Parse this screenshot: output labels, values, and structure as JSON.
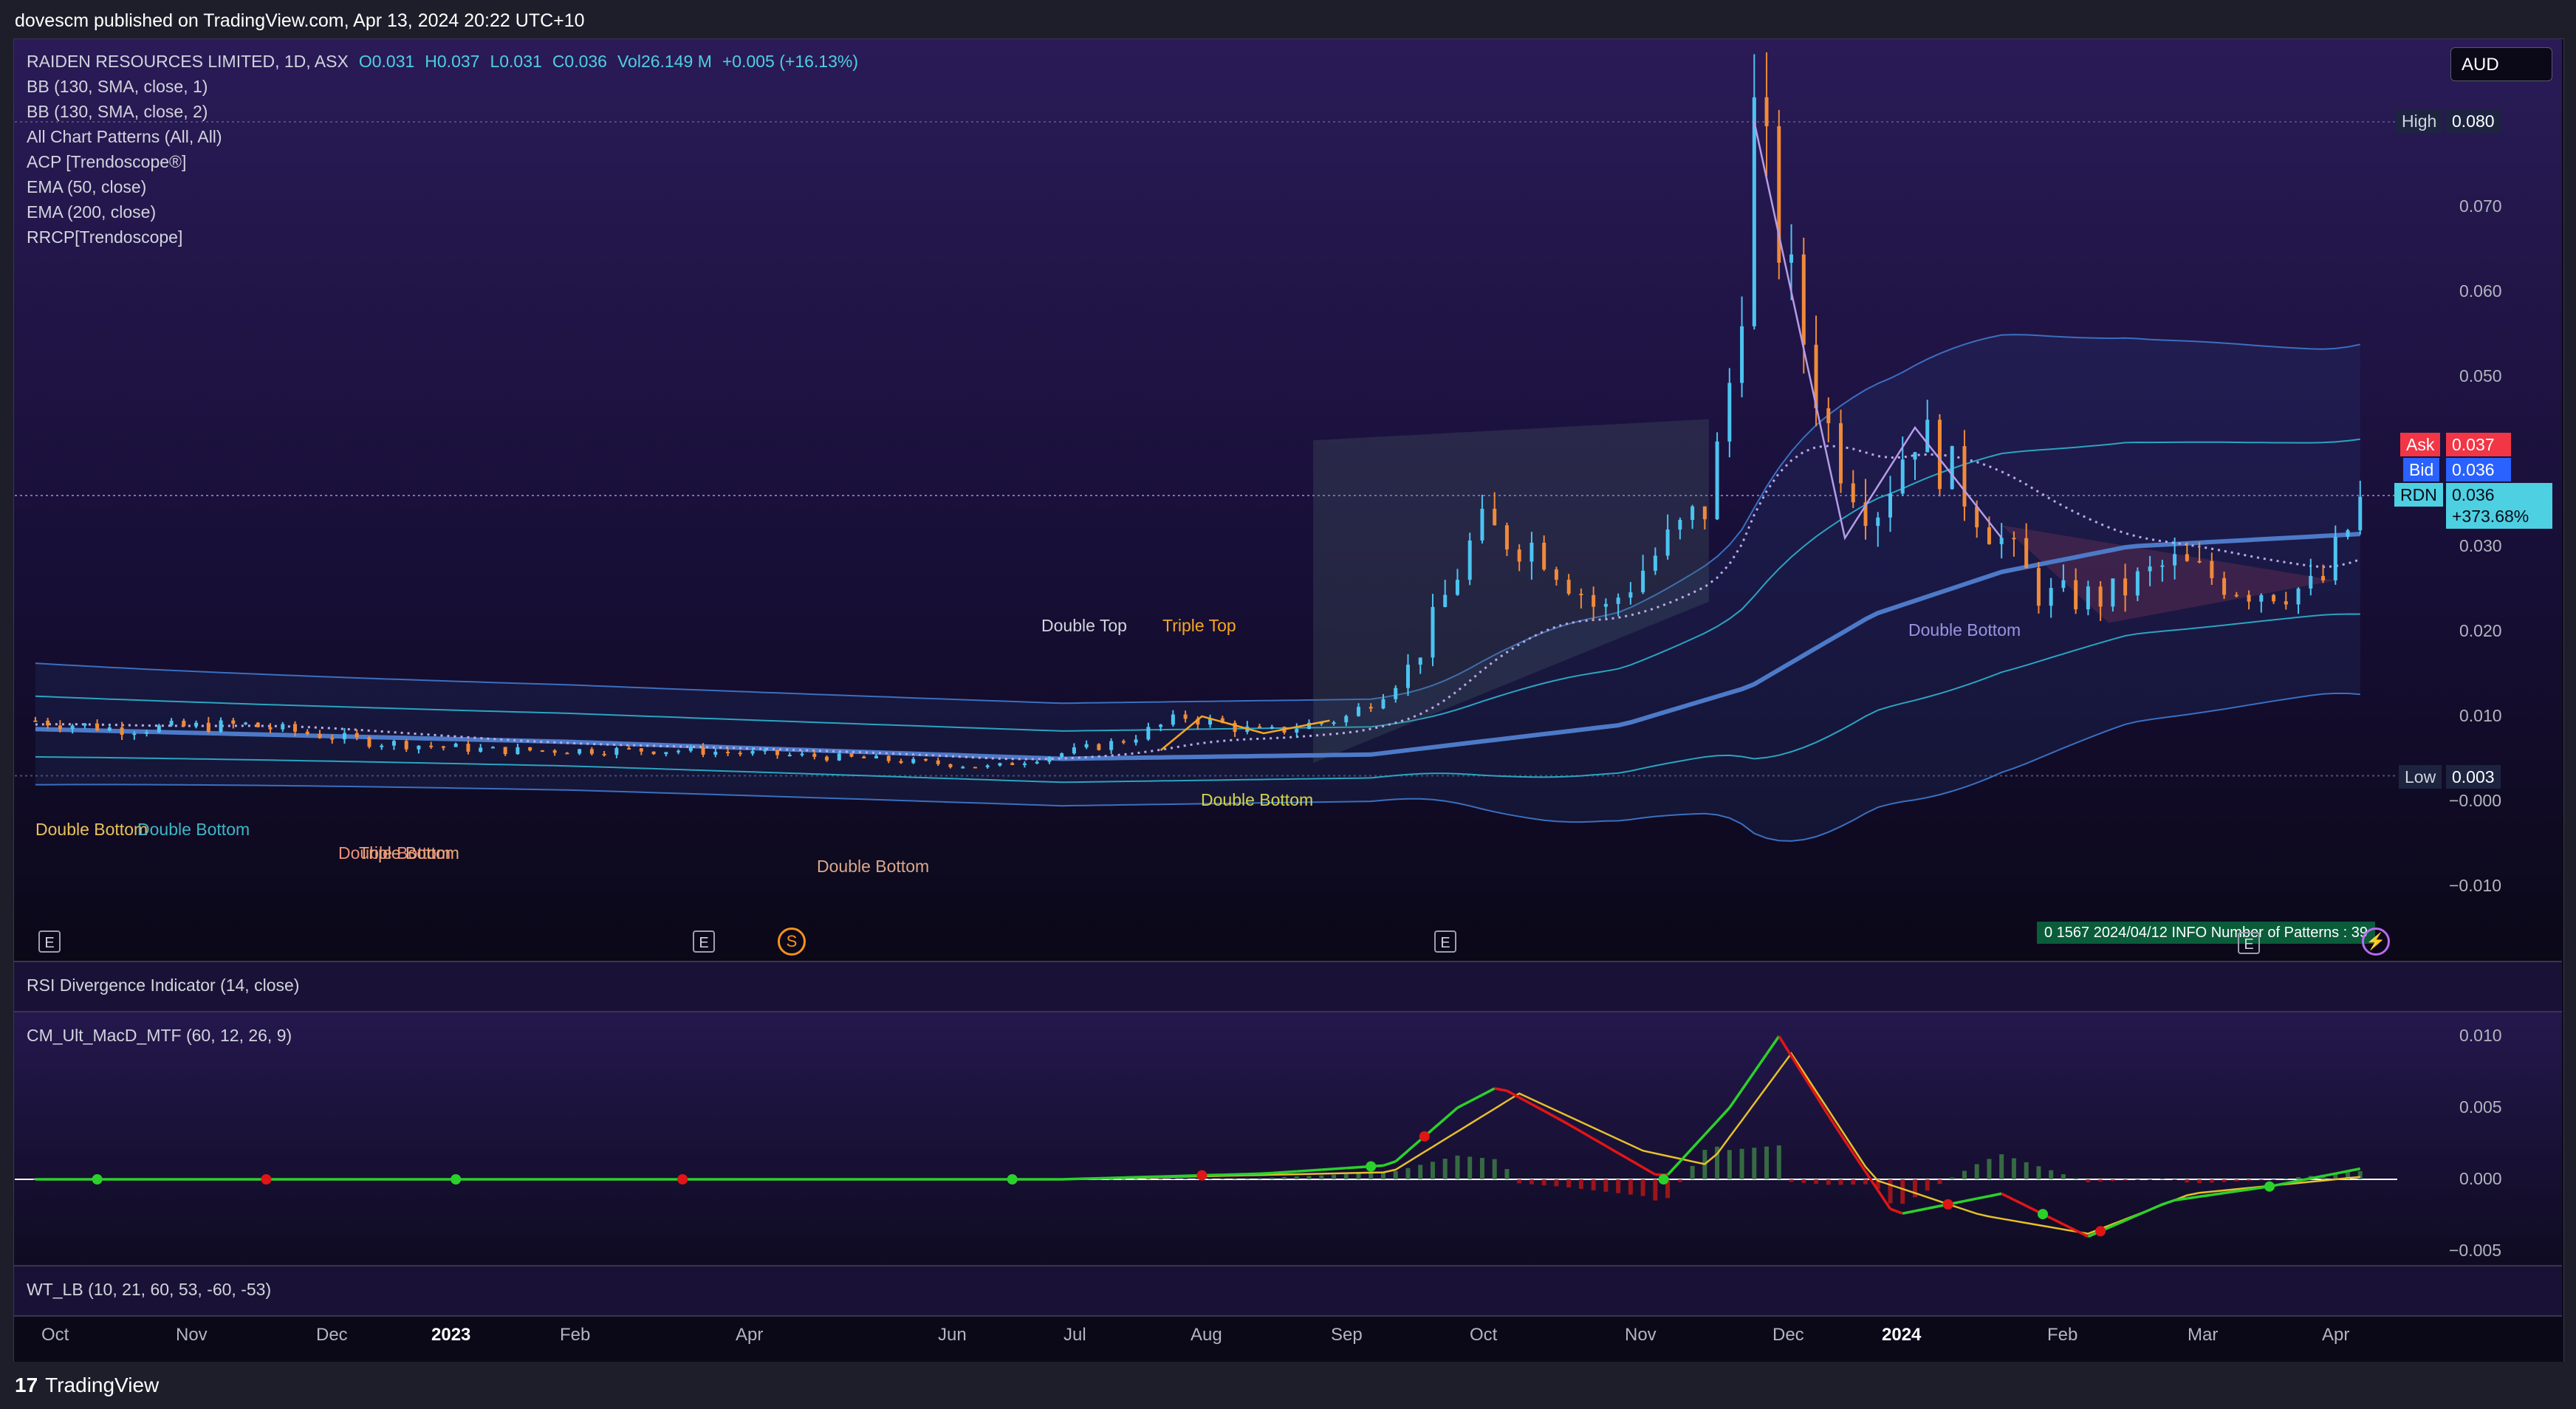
{
  "publisher": "dovescm published on TradingView.com, Apr 13, 2024 20:22 UTC+10",
  "symbol_line": {
    "name": "RAIDEN RESOURCES LIMITED, 1D, ASX",
    "open": "O0.031",
    "high": "H0.037",
    "low": "L0.031",
    "close": "C0.036",
    "vol": "Vol26.149 M",
    "change": "+0.005 (+16.13%)"
  },
  "indicators": [
    "BB (130, SMA, close, 1)",
    "BB (130, SMA, close, 2)",
    "All Chart Patterns (All, All)",
    "ACP [Trendoscope®]",
    "EMA (50, close)",
    "EMA (200, close)",
    "RRCP[Trendoscope]"
  ],
  "currency_button": "AUD",
  "panes": {
    "rsi": "RSI Divergence Indicator (14, close)",
    "macd": "CM_Ult_MacD_MTF (60, 12, 26, 9)",
    "wt": "WT_LB (10, 21, 60, 53, -60, -53)"
  },
  "price_tags": {
    "high_label": "High",
    "high_value": "0.080",
    "low_label": "Low",
    "low_value": "0.003",
    "ask_label": "Ask",
    "ask_value": "0.037",
    "bid_label": "Bid",
    "bid_value": "0.036",
    "sym_label": "RDN",
    "sym_value": "0.036",
    "sym_change": "+373.68%"
  },
  "pattern_labels": [
    {
      "text": "Double Bottom",
      "color": "#e8c15a"
    },
    {
      "text": "Double Bottom",
      "color": "#3fb5c8"
    },
    {
      "text": "Double Bottom",
      "color": "#f08f7a"
    },
    {
      "text": "Triple Bottom",
      "color": "#e8a878"
    },
    {
      "text": "Double Bottom",
      "color": "#d9a98c"
    },
    {
      "text": "Double Top",
      "color": "#d1d4dc"
    },
    {
      "text": "Triple Top",
      "color": "#f5a623"
    },
    {
      "text": "Double Bottom",
      "color": "#d4d44a"
    },
    {
      "text": "Double Bottom",
      "color": "#9b94e0"
    }
  ],
  "badges": {
    "earnings": "E",
    "split": "S",
    "bolt": "⚡"
  },
  "info_table": "0    1567   2024/04/12   INFO   Number of Patterns : 39",
  "footer_brand": "TradingView",
  "footer_logo": "17",
  "chart_data": [
    {
      "type": "candlestick",
      "title": "RAIDEN RESOURCES LIMITED, 1D, ASX",
      "x_ticks": [
        "Oct",
        "Nov",
        "Dec",
        "2023",
        "Feb",
        "Apr",
        "Jun",
        "Jul",
        "Aug",
        "Sep",
        "Oct",
        "Nov",
        "Dec",
        "2024",
        "Feb",
        "Mar",
        "Apr"
      ],
      "y_ticks": [
        "0.070",
        "0.060",
        "0.050",
        "0.030",
        "0.020",
        "0.010",
        "−0.000",
        "−0.010"
      ],
      "ylim": [
        -0.0135,
        0.0845
      ],
      "close_path": [
        [
          "2022-09-25",
          0.0095
        ],
        [
          "2022-10-15",
          0.0085
        ],
        [
          "2022-11-15",
          0.009
        ],
        [
          "2022-12-15",
          0.007
        ],
        [
          "2023-01-15",
          0.006
        ],
        [
          "2023-03-01",
          0.006
        ],
        [
          "2023-04-15",
          0.005
        ],
        [
          "2023-05-15",
          0.004
        ],
        [
          "2023-06-15",
          0.007
        ],
        [
          "2023-07-01",
          0.01
        ],
        [
          "2023-07-20",
          0.008
        ],
        [
          "2023-08-10",
          0.01
        ],
        [
          "2023-08-25",
          0.016
        ],
        [
          "2023-09-10",
          0.032
        ],
        [
          "2023-09-25",
          0.03
        ],
        [
          "2023-10-10",
          0.022
        ],
        [
          "2023-10-25",
          0.03
        ],
        [
          "2023-11-05",
          0.035
        ],
        [
          "2023-11-12",
          0.055
        ],
        [
          "2023-11-16",
          0.08
        ],
        [
          "2023-11-25",
          0.06
        ],
        [
          "2023-12-05",
          0.042
        ],
        [
          "2023-12-15",
          0.034
        ],
        [
          "2023-12-25",
          0.044
        ],
        [
          "2024-01-10",
          0.034
        ],
        [
          "2024-01-25",
          0.024
        ],
        [
          "2024-02-10",
          0.024
        ],
        [
          "2024-02-25",
          0.028
        ],
        [
          "2024-03-15",
          0.025
        ],
        [
          "2024-04-01",
          0.025
        ],
        [
          "2024-04-12",
          0.036
        ]
      ],
      "ema_200": [
        [
          "2022-09-25",
          0.0085
        ],
        [
          "2023-02-01",
          0.007
        ],
        [
          "2023-06-01",
          0.005
        ],
        [
          "2023-08-15",
          0.0055
        ],
        [
          "2023-10-15",
          0.009
        ],
        [
          "2023-11-15",
          0.0135
        ],
        [
          "2023-12-15",
          0.022
        ],
        [
          "2024-01-15",
          0.027
        ],
        [
          "2024-02-15",
          0.03
        ],
        [
          "2024-04-12",
          0.0315
        ]
      ],
      "high_label": 0.08,
      "low_label": 0.003,
      "last_price": 0.036
    },
    {
      "type": "bar",
      "title": "CM_Ult_MacD_MTF (60, 12, 26, 9)",
      "y_ticks": [
        "0.010",
        "0.005",
        "0.000",
        "−0.005"
      ],
      "ylim": [
        -0.0075,
        0.0115
      ],
      "macd_line": [
        [
          "2022-09-25",
          0.0
        ],
        [
          "2023-06-01",
          0.0
        ],
        [
          "2023-07-20",
          0.0004
        ],
        [
          "2023-08-20",
          0.001
        ],
        [
          "2023-09-05",
          0.005
        ],
        [
          "2023-09-15",
          0.0065
        ],
        [
          "2023-10-01",
          0.004
        ],
        [
          "2023-10-25",
          0.0
        ],
        [
          "2023-11-10",
          0.005
        ],
        [
          "2023-11-22",
          0.01
        ],
        [
          "2023-12-05",
          0.004
        ],
        [
          "2023-12-20",
          -0.0025
        ],
        [
          "2024-01-15",
          -0.001
        ],
        [
          "2024-02-05",
          -0.004
        ],
        [
          "2024-02-25",
          -0.0015
        ],
        [
          "2024-03-20",
          -0.0005
        ],
        [
          "2024-04-12",
          0.0008
        ]
      ],
      "signal_line": [
        [
          "2022-09-25",
          0.0
        ],
        [
          "2023-06-01",
          0.0
        ],
        [
          "2023-08-20",
          0.0005
        ],
        [
          "2023-09-20",
          0.006
        ],
        [
          "2023-10-20",
          0.002
        ],
        [
          "2023-11-05",
          0.001
        ],
        [
          "2023-11-25",
          0.0088
        ],
        [
          "2023-12-15",
          0.0
        ],
        [
          "2024-01-10",
          -0.0025
        ],
        [
          "2024-02-05",
          -0.0038
        ],
        [
          "2024-03-01",
          -0.001
        ],
        [
          "2024-04-12",
          0.0002
        ]
      ]
    }
  ]
}
